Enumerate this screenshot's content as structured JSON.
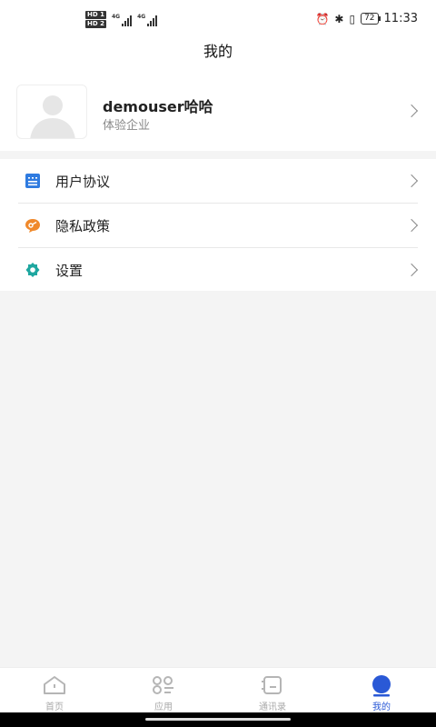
{
  "status_bar": {
    "hd1": "HD 1",
    "hd2": "HD 2",
    "net1": "4G",
    "net2": "4G",
    "battery": "72",
    "time": "11:33"
  },
  "header": {
    "title": "我的"
  },
  "profile": {
    "username": "demouser哈哈",
    "company": "体验企业"
  },
  "menu": {
    "items": [
      {
        "label": "用户协议",
        "icon": "document-icon",
        "color": "#2f7be0"
      },
      {
        "label": "隐私政策",
        "icon": "privacy-icon",
        "color": "#f0892b"
      },
      {
        "label": "设置",
        "icon": "gear-icon",
        "color": "#1fa7a0"
      }
    ]
  },
  "tabs": [
    {
      "label": "首页",
      "icon": "home-icon",
      "active": false
    },
    {
      "label": "应用",
      "icon": "apps-icon",
      "active": false
    },
    {
      "label": "通讯录",
      "icon": "contacts-icon",
      "active": false
    },
    {
      "label": "我的",
      "icon": "profile-icon",
      "active": true
    }
  ],
  "colors": {
    "accent": "#2a59d6",
    "inactive": "#aaaaaa"
  }
}
